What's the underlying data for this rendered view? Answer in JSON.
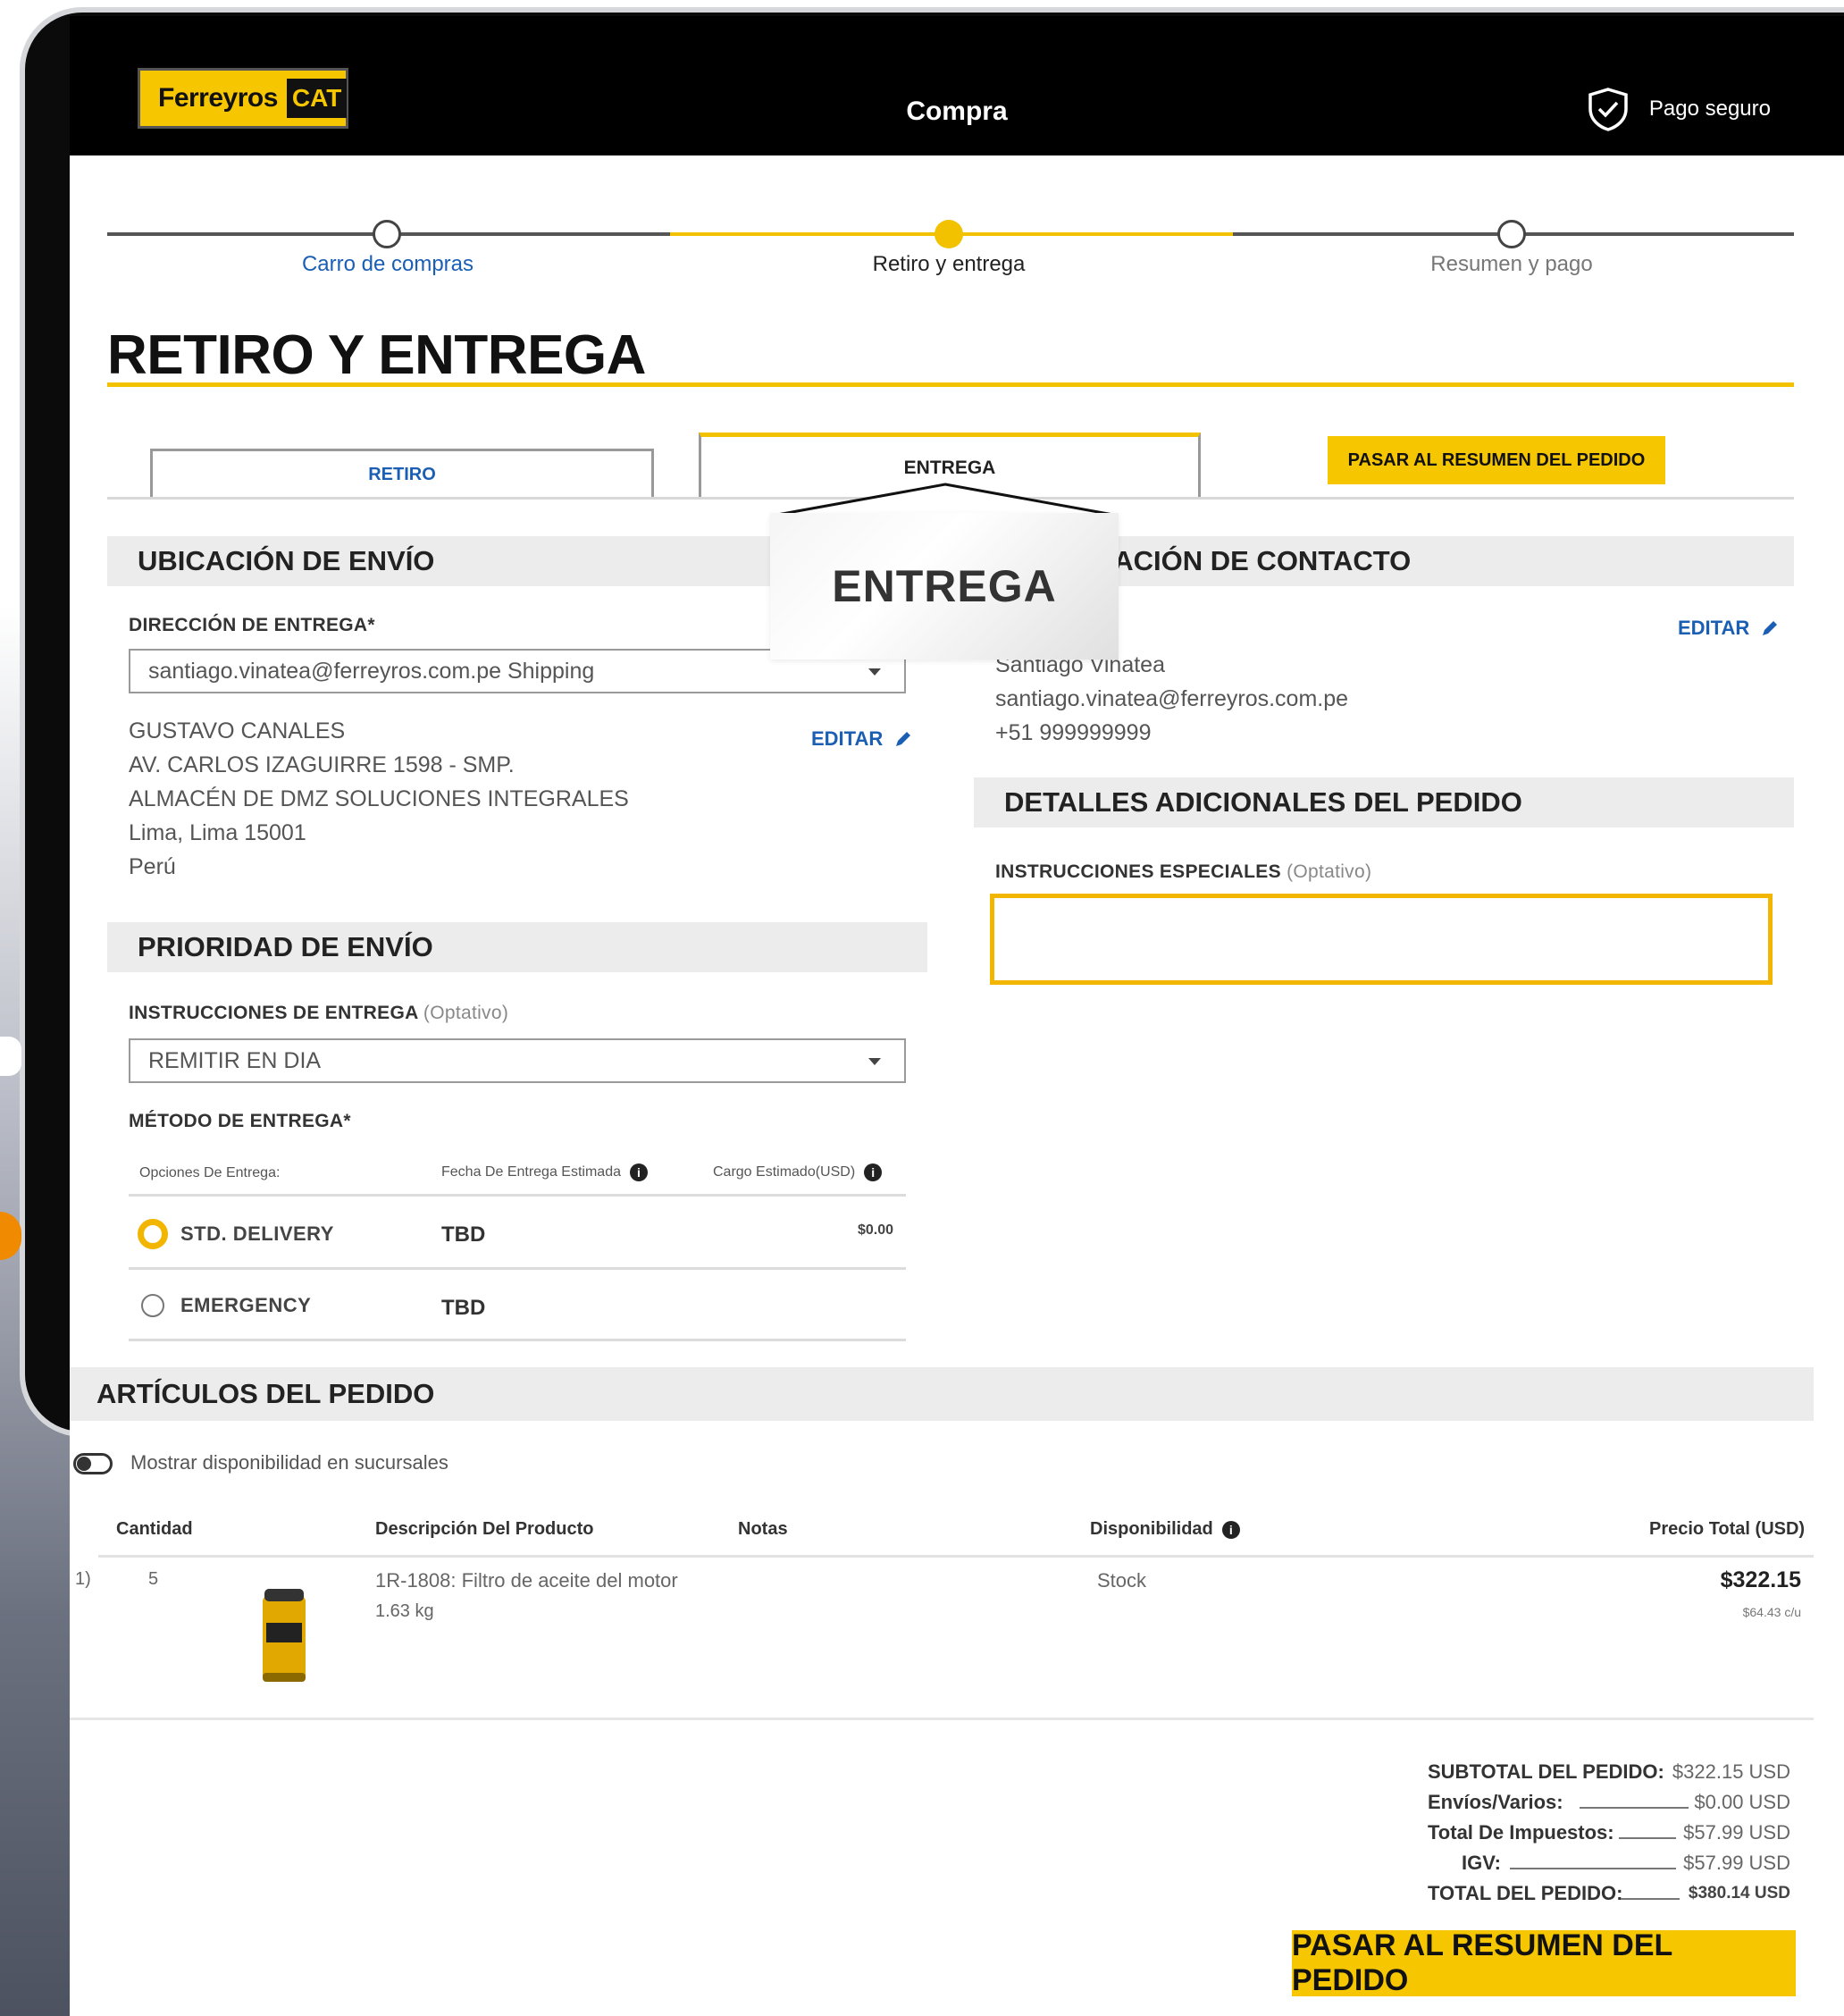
{
  "header": {
    "logo_text": "Ferreyros",
    "logo_cat": "CAT",
    "title": "Compra",
    "secure_label": "Pago seguro"
  },
  "progress": {
    "steps": [
      {
        "label": "Carro de compras"
      },
      {
        "label": "Retiro y entrega"
      },
      {
        "label": "Resumen y pago"
      }
    ]
  },
  "page_title": "RETIRO Y ENTREGA",
  "tabs": {
    "retiro": "RETIRO",
    "entrega": "ENTREGA",
    "summary_button": "PASAR AL RESUMEN DEL PEDIDO"
  },
  "tooltip": {
    "text": "ENTREGA"
  },
  "shipping": {
    "section_title": "UBICACIÓN DE ENVÍO",
    "address_label": "DIRECCIÓN DE ENTREGA*",
    "address_select": "santiago.vinatea@ferreyros.com.pe Shipping",
    "edit_label": "EDITAR",
    "address_lines": [
      "GUSTAVO CANALES",
      "AV. CARLOS IZAGUIRRE 1598 - SMP.",
      "ALMACÉN DE DMZ SOLUCIONES INTEGRALES",
      "Lima, Lima 15001",
      "Perú"
    ]
  },
  "priority": {
    "section_title": "PRIORIDAD DE ENVÍO",
    "instructions_label": "INSTRUCCIONES DE ENTREGA",
    "optional": "(Optativo)",
    "instructions_value": "REMITIR EN DIA",
    "method_label": "MÉTODO DE ENTREGA*",
    "col_options": "Opciones De Entrega:",
    "col_date": "Fecha De Entrega Estimada",
    "col_cost": "Cargo Estimado(USD)",
    "options": [
      {
        "name": "STD. DELIVERY",
        "date": "TBD",
        "cost": "$0.00",
        "selected": true
      },
      {
        "name": "EMERGENCY",
        "date": "TBD",
        "cost": "",
        "selected": false
      }
    ]
  },
  "contact": {
    "section_title": "INFORMACIÓN DE CONTACTO",
    "edit_label": "EDITAR",
    "name": "Santiago Vinatea",
    "email": "santiago.vinatea@ferreyros.com.pe",
    "phone": "+51 999999999"
  },
  "details": {
    "section_title": "DETALLES ADICIONALES DEL PEDIDO",
    "instructions_label": "INSTRUCCIONES ESPECIALES",
    "optional": "(Optativo)",
    "instructions_value": ""
  },
  "articles": {
    "section_title": "ARTÍCULOS DEL PEDIDO",
    "toggle_label": "Mostrar disponibilidad en sucursales",
    "columns": {
      "qty": "Cantidad",
      "desc": "Descripción Del Producto",
      "notes": "Notas",
      "availability": "Disponibilidad",
      "total": "Precio Total (USD)"
    },
    "rows": [
      {
        "index": "1)",
        "qty": "5",
        "desc": "1R-1808: Filtro de aceite del motor",
        "weight": "1.63 kg",
        "availability": "Stock",
        "total": "$322.15",
        "unit": "$64.43 c/u"
      }
    ]
  },
  "totals": {
    "subtotal_label": "SUBTOTAL DEL PEDIDO:",
    "subtotal_value": "$322.15 USD",
    "shipping_label": "Envíos/Varios:",
    "shipping_value": "$0.00 USD",
    "tax_label": "Total De Impuestos:",
    "tax_value": "$57.99 USD",
    "igv_label": "IGV:",
    "igv_value": "$57.99 USD",
    "total_label": "TOTAL DEL PEDIDO:",
    "total_value": "$380.14 USD"
  },
  "bottom_button": "PASAR AL RESUMEN DEL PEDIDO",
  "colors": {
    "brand_yellow": "#f6c700",
    "accent_line": "#f2c200",
    "link_blue": "#1a5fb4",
    "radio_orange": "#f2b600"
  }
}
